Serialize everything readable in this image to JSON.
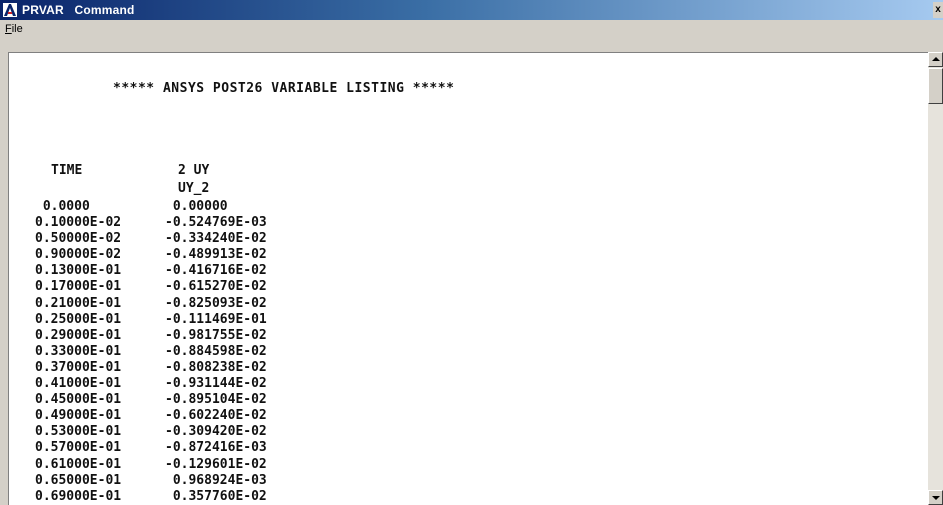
{
  "window": {
    "app_name": "PRVAR",
    "title": "Command",
    "close_glyph": "x"
  },
  "menu": {
    "file_accel": "F",
    "file_rest": "ile"
  },
  "listing": {
    "heading": "***** ANSYS POST26 VARIABLE LISTING *****",
    "col_time": "TIME",
    "col_var": "2 UY",
    "col_var_name": "UY_2",
    "rows": [
      {
        "time": " 0.0000",
        "value": " 0.00000"
      },
      {
        "time": "0.10000E-02",
        "value": "-0.524769E-03"
      },
      {
        "time": "0.50000E-02",
        "value": "-0.334240E-02"
      },
      {
        "time": "0.90000E-02",
        "value": "-0.489913E-02"
      },
      {
        "time": "0.13000E-01",
        "value": "-0.416716E-02"
      },
      {
        "time": "0.17000E-01",
        "value": "-0.615270E-02"
      },
      {
        "time": "0.21000E-01",
        "value": "-0.825093E-02"
      },
      {
        "time": "0.25000E-01",
        "value": "-0.111469E-01"
      },
      {
        "time": "0.29000E-01",
        "value": "-0.981755E-02"
      },
      {
        "time": "0.33000E-01",
        "value": "-0.884598E-02"
      },
      {
        "time": "0.37000E-01",
        "value": "-0.808238E-02"
      },
      {
        "time": "0.41000E-01",
        "value": "-0.931144E-02"
      },
      {
        "time": "0.45000E-01",
        "value": "-0.895104E-02"
      },
      {
        "time": "0.49000E-01",
        "value": "-0.602240E-02"
      },
      {
        "time": "0.53000E-01",
        "value": "-0.309420E-02"
      },
      {
        "time": "0.57000E-01",
        "value": "-0.872416E-03"
      },
      {
        "time": "0.61000E-01",
        "value": "-0.129601E-02"
      },
      {
        "time": "0.65000E-01",
        "value": " 0.968924E-03"
      },
      {
        "time": "0.69000E-01",
        "value": " 0.357760E-02"
      }
    ]
  },
  "icons": {
    "app": "ansys-logo-icon",
    "scroll_up": "arrow-up-icon",
    "scroll_down": "arrow-down-icon"
  },
  "colors": {
    "titlebar_start": "#0a246a",
    "titlebar_end": "#a6caf0",
    "logo_red": "#cc2222"
  }
}
